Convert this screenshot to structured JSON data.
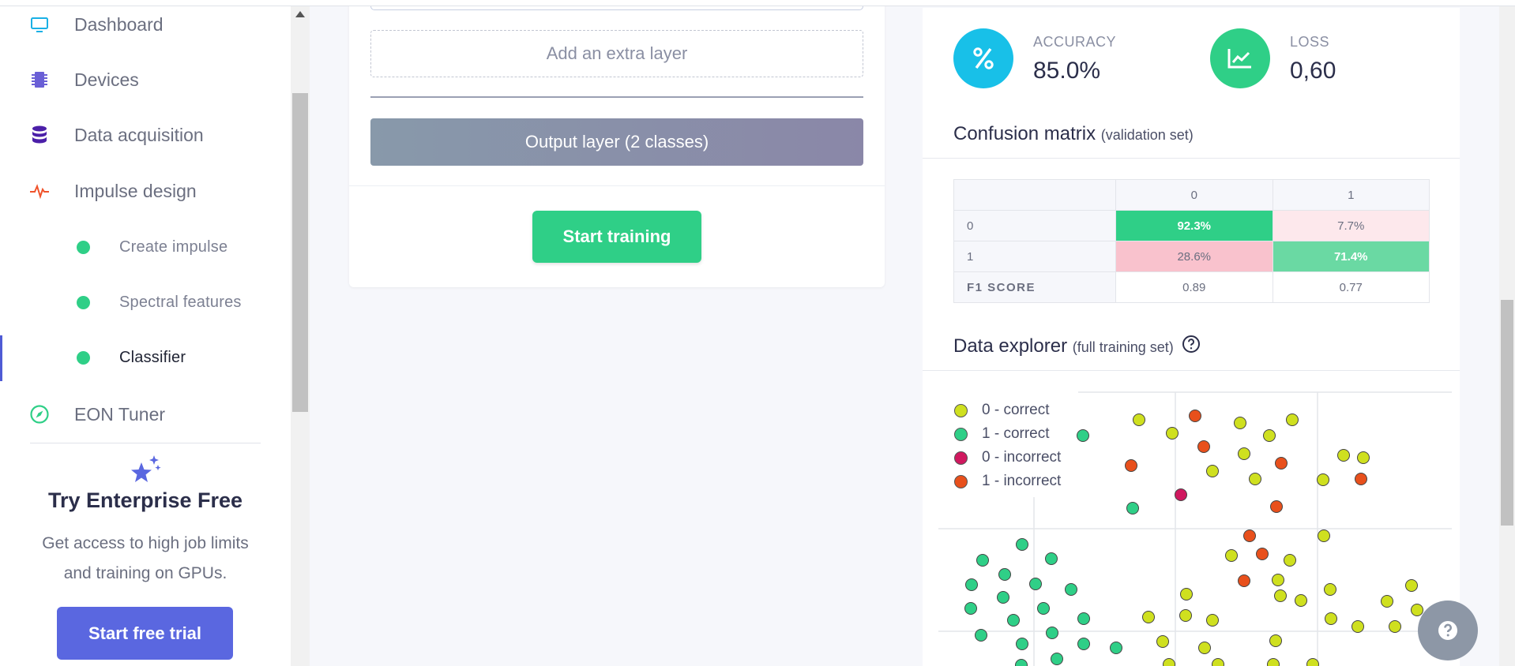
{
  "sidebar": {
    "items": [
      {
        "label": "Dashboard",
        "icon": "monitor-icon"
      },
      {
        "label": "Devices",
        "icon": "chip-icon"
      },
      {
        "label": "Data acquisition",
        "icon": "database-icon"
      },
      {
        "label": "Impulse design",
        "icon": "pulse-icon"
      }
    ],
    "subitems": [
      {
        "label": "Create impulse"
      },
      {
        "label": "Spectral features"
      },
      {
        "label": "Classifier"
      }
    ],
    "eon": {
      "label": "EON Tuner",
      "icon": "compass-icon"
    },
    "promo": {
      "title": "Try Enterprise Free",
      "description": "Get access to high job limits and training on GPUs.",
      "button": "Start free trial"
    }
  },
  "training": {
    "extra_layer": "Add an extra layer",
    "output_layer": "Output layer (2 classes)",
    "start_button": "Start training"
  },
  "metrics": {
    "accuracy_label": "ACCURACY",
    "accuracy_value": "85.0%",
    "loss_label": "LOSS",
    "loss_value": "0,60"
  },
  "confusion": {
    "title": "Confusion matrix",
    "subtitle": "(validation set)",
    "columns": [
      "0",
      "1"
    ],
    "rows": [
      {
        "label": "0",
        "values": [
          "92.3%",
          "7.7%"
        ]
      },
      {
        "label": "1",
        "values": [
          "28.6%",
          "71.4%"
        ]
      }
    ],
    "f1_label": "F1 SCORE",
    "f1_values": [
      "0.89",
      "0.77"
    ]
  },
  "explorer": {
    "title": "Data explorer",
    "subtitle": "(full training set)",
    "legend": [
      {
        "label": "0 - correct",
        "color": "#cfe01f"
      },
      {
        "label": "1 - correct",
        "color": "#2fcf87"
      },
      {
        "label": "0 - incorrect",
        "color": "#d0185f"
      },
      {
        "label": "1 - incorrect",
        "color": "#e8501c"
      }
    ],
    "points": [
      [
        1442,
        532,
        0
      ],
      [
        1484,
        549,
        0
      ],
      [
        1570,
        536,
        0
      ],
      [
        1636,
        532,
        0
      ],
      [
        1607,
        552,
        0
      ],
      [
        1575,
        575,
        0
      ],
      [
        1535,
        597,
        0
      ],
      [
        1589,
        607,
        0
      ],
      [
        1675,
        608,
        0
      ],
      [
        1701,
        577,
        0
      ],
      [
        1633,
        710,
        0
      ],
      [
        1676,
        679,
        0
      ],
      [
        1618,
        735,
        0
      ],
      [
        1559,
        704,
        0
      ],
      [
        1621,
        755,
        0
      ],
      [
        1647,
        761,
        0
      ],
      [
        1684,
        747,
        0
      ],
      [
        1502,
        753,
        0
      ],
      [
        1501,
        780,
        0
      ],
      [
        1535,
        786,
        0
      ],
      [
        1454,
        782,
        0
      ],
      [
        1472,
        813,
        0
      ],
      [
        1525,
        821,
        0
      ],
      [
        1685,
        784,
        0
      ],
      [
        1719,
        794,
        0
      ],
      [
        1756,
        762,
        0
      ],
      [
        1787,
        742,
        0
      ],
      [
        1794,
        773,
        0
      ],
      [
        1766,
        794,
        0
      ],
      [
        1726,
        580,
        0
      ],
      [
        1615,
        812,
        0
      ],
      [
        1662,
        842,
        0
      ],
      [
        1612,
        842,
        0
      ],
      [
        1542,
        842,
        0
      ],
      [
        1480,
        842,
        0
      ],
      [
        1371,
        552,
        1
      ],
      [
        1434,
        644,
        1
      ],
      [
        1244,
        710,
        1
      ],
      [
        1294,
        690,
        1
      ],
      [
        1331,
        708,
        1
      ],
      [
        1230,
        741,
        1
      ],
      [
        1272,
        728,
        1
      ],
      [
        1311,
        740,
        1
      ],
      [
        1356,
        747,
        1
      ],
      [
        1229,
        771,
        1
      ],
      [
        1270,
        757,
        1
      ],
      [
        1321,
        771,
        1
      ],
      [
        1283,
        786,
        1
      ],
      [
        1332,
        802,
        1
      ],
      [
        1372,
        784,
        1
      ],
      [
        1242,
        805,
        1
      ],
      [
        1294,
        816,
        1
      ],
      [
        1372,
        816,
        1
      ],
      [
        1413,
        821,
        1
      ],
      [
        1338,
        835,
        1
      ],
      [
        1293,
        843,
        1
      ],
      [
        1495,
        627,
        2
      ],
      [
        1513,
        527,
        3
      ],
      [
        1524,
        566,
        3
      ],
      [
        1432,
        590,
        3
      ],
      [
        1622,
        587,
        3
      ],
      [
        1616,
        642,
        3
      ],
      [
        1582,
        679,
        3
      ],
      [
        1598,
        702,
        3
      ],
      [
        1575,
        736,
        3
      ],
      [
        1723,
        607,
        3
      ]
    ]
  }
}
